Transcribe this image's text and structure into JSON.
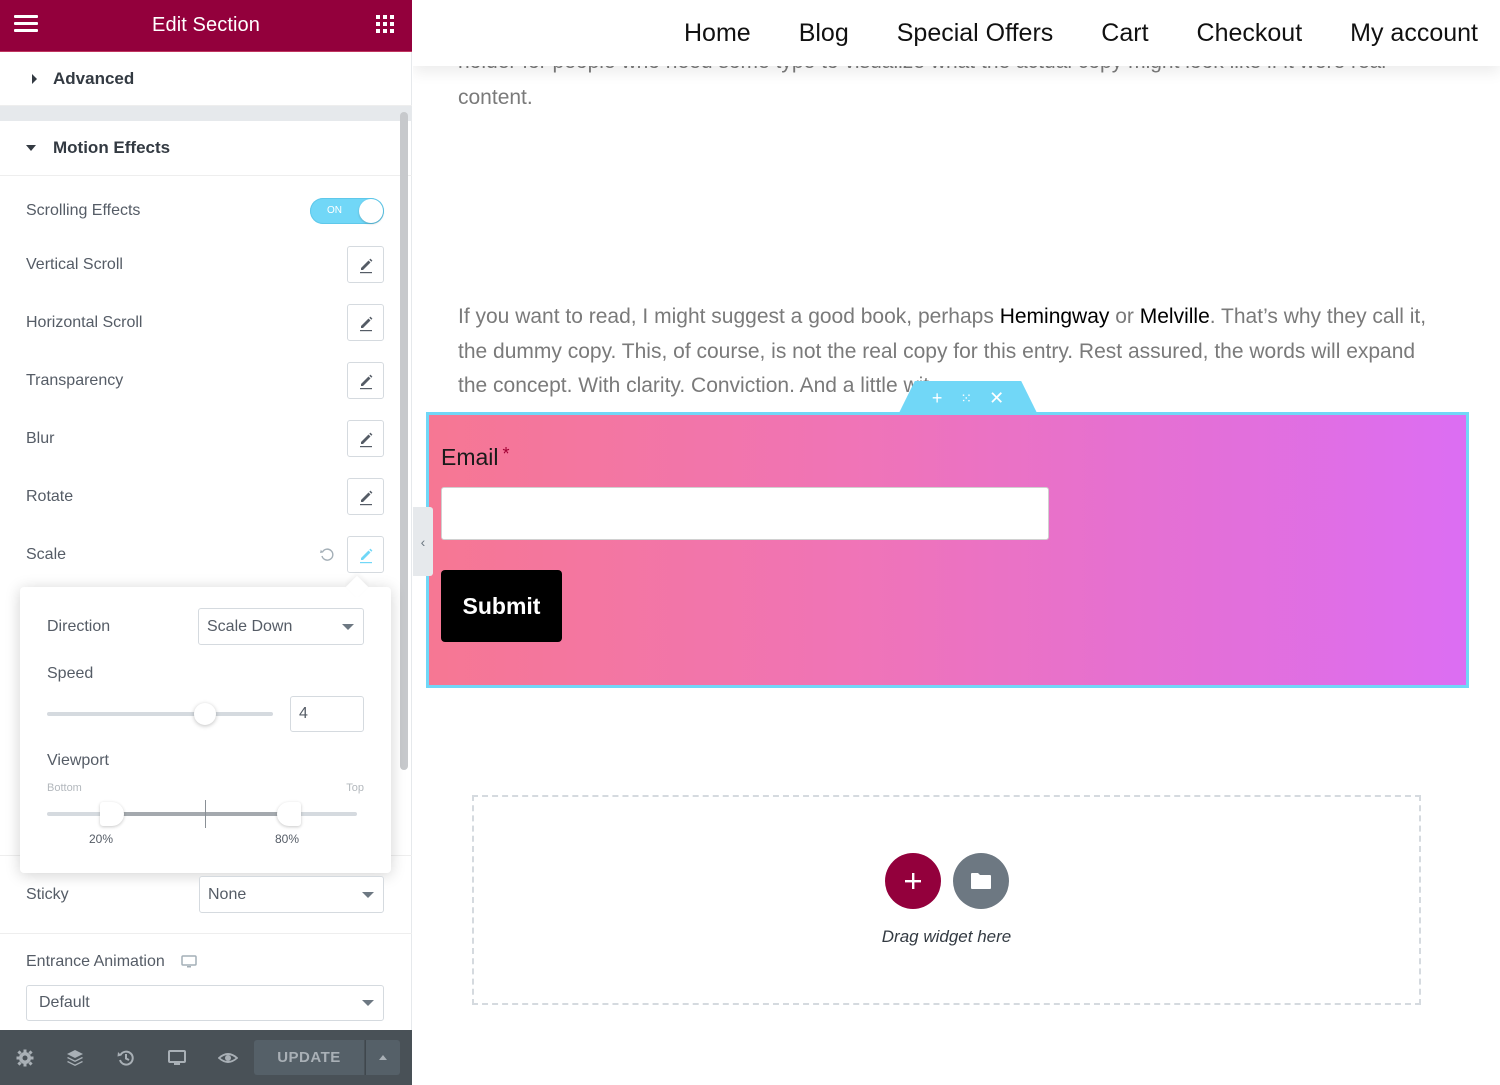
{
  "panel": {
    "title": "Edit Section",
    "sections": {
      "advanced": "Advanced",
      "motion_effects": "Motion Effects"
    },
    "controls": {
      "scrolling_effects": {
        "label": "Scrolling Effects",
        "toggle_text": "ON",
        "enabled": true
      },
      "vertical_scroll": "Vertical Scroll",
      "horizontal_scroll": "Horizontal Scroll",
      "transparency": "Transparency",
      "blur": "Blur",
      "rotate": "Rotate",
      "scale": "Scale"
    },
    "popover": {
      "direction_label": "Direction",
      "direction_value": "Scale Down",
      "speed_label": "Speed",
      "speed_value": "4",
      "speed_range": [
        0,
        10
      ],
      "viewport_label": "Viewport",
      "viewport_bottom_label": "Bottom",
      "viewport_top_label": "Top",
      "viewport_start": "20%",
      "viewport_end": "80%"
    },
    "sticky": {
      "label": "Sticky",
      "value": "None"
    },
    "entrance_animation": {
      "label": "Entrance Animation",
      "value": "Default"
    },
    "footer": {
      "update_label": "UPDATE"
    },
    "colors": {
      "brand": "#93003c",
      "accent": "#71d7f7",
      "footer": "#495157"
    }
  },
  "canvas": {
    "nav": [
      "Home",
      "Blog",
      "Special Offers",
      "Cart",
      "Checkout",
      "My account"
    ],
    "cut_text": "holder for people who need some type to visualize what the actual copy might look like if it were real",
    "content_text": "content.",
    "paragraph": {
      "part1": "If you want to read, I might suggest a good book, perhaps ",
      "bold1": "Hemingway",
      "part2": " or ",
      "bold2": "Melville",
      "part3": ". That’s why they call it, the dummy copy. This, of course, is not the real copy for this entry. Rest assured, the words will expand the concept. With clarity. Conviction. And a little wit."
    },
    "form": {
      "email_label": "Email",
      "required_mark": "*",
      "email_value": "",
      "submit_label": "Submit",
      "gradient": [
        "#f67793",
        "#dc6ef3"
      ]
    },
    "drop_zone": {
      "text": "Drag widget here"
    }
  }
}
